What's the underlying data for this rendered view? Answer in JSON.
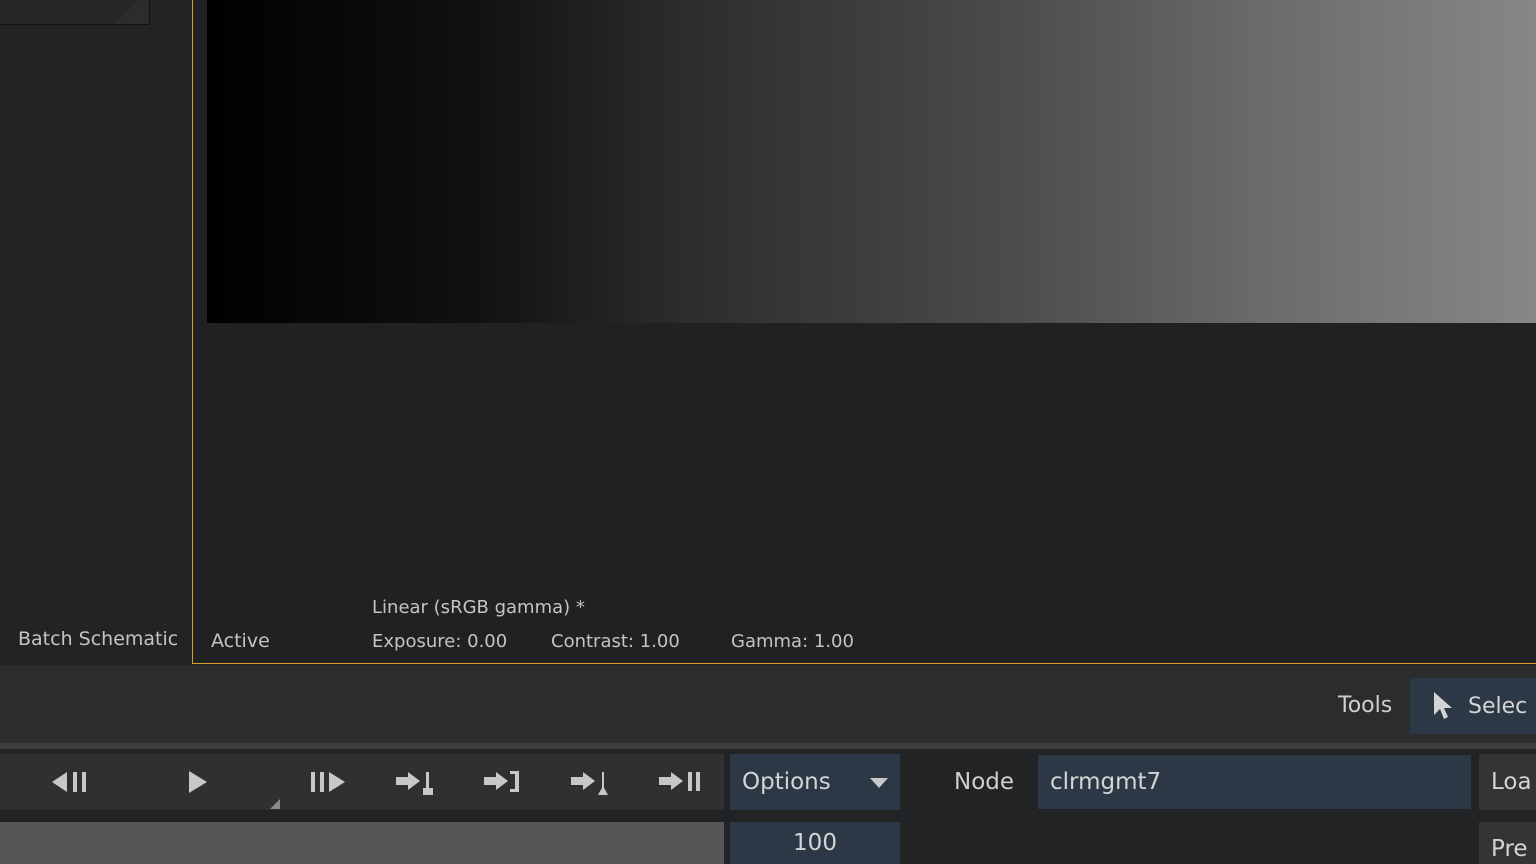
{
  "left_panel": {
    "label": "Batch Schematic"
  },
  "viewer": {
    "status": "Active",
    "colorspace": "Linear (sRGB gamma) *",
    "exposure": "Exposure: 0.00",
    "contrast": "Contrast: 1.00",
    "gamma": "Gamma: 1.00"
  },
  "tools": {
    "label": "Tools",
    "select_label": "Selec"
  },
  "transport": {
    "buttons": [
      "step-back",
      "play",
      "step-forward",
      "go-in-point",
      "go-out-point",
      "go-in-mark",
      "go-end"
    ]
  },
  "options": {
    "label": "Options"
  },
  "node": {
    "label": "Node",
    "value": "clrmgmt7"
  },
  "load": {
    "label": "Loa"
  },
  "frame": {
    "value": "100"
  },
  "preview": {
    "label": "Pre"
  },
  "colors": {
    "accent_border": "#d89e2a",
    "button_blue": "#2c3846"
  }
}
